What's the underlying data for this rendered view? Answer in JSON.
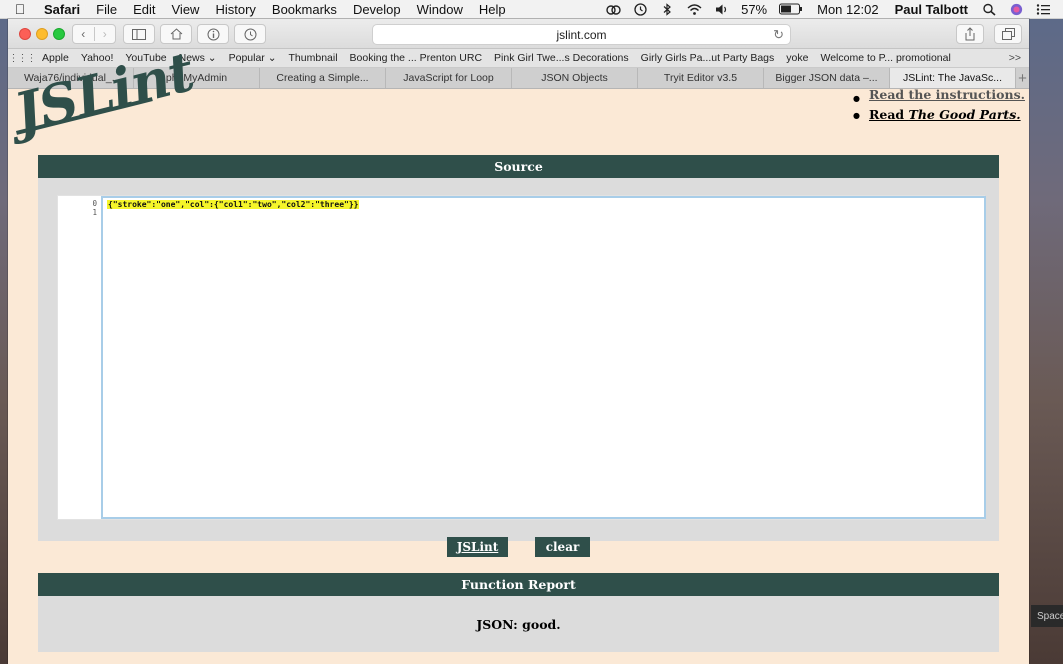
{
  "menubar": {
    "app": "Safari",
    "menus": [
      "File",
      "Edit",
      "View",
      "History",
      "Bookmarks",
      "Develop",
      "Window",
      "Help"
    ],
    "battery": "57%",
    "clock": "Mon 12:02",
    "user": "Paul Talbott"
  },
  "browser": {
    "url": "jslint.com",
    "favorites": [
      "Apple",
      "Yahoo!",
      "YouTube",
      "News ⌄",
      "Popular ⌄",
      "Thumbnail",
      "Booking the ... Prenton URC",
      "Pink Girl Twe...s Decorations",
      "Girly Girls Pa...ut Party Bags",
      "yoke",
      "Welcome to P... promotional"
    ],
    "favorites_more": ">>",
    "tabs": [
      "Waja76/individual_...",
      "phpMyAdmin",
      "Creating a Simple...",
      "JavaScript for Loop",
      "JSON Objects",
      "Tryit Editor v3.5",
      "Bigger JSON data –...",
      "JSLint: The JavaSc..."
    ],
    "active_tab": 7
  },
  "page": {
    "logo": "JSLint",
    "links": {
      "instructions": "Read the instructions.",
      "good_parts_prefix": "Read ",
      "good_parts_title": "The Good Parts."
    },
    "source_title": "Source",
    "line_numbers": [
      "0",
      "1"
    ],
    "code": "{\"stroke\":\"one\",\"col\":{\"col1\":\"two\",\"col2\":\"three\"}}",
    "buttons": {
      "jslint": "JSLint",
      "clear": "clear"
    },
    "report_title": "Function Report",
    "report_text": "JSON: good."
  },
  "desktop": {
    "space_label": "Space"
  },
  "colors": {
    "accent": "#2f4f4a",
    "page_background": "#fbe9d6",
    "panel": "#dcdcdc",
    "code_highlight": "#f5f52a"
  }
}
